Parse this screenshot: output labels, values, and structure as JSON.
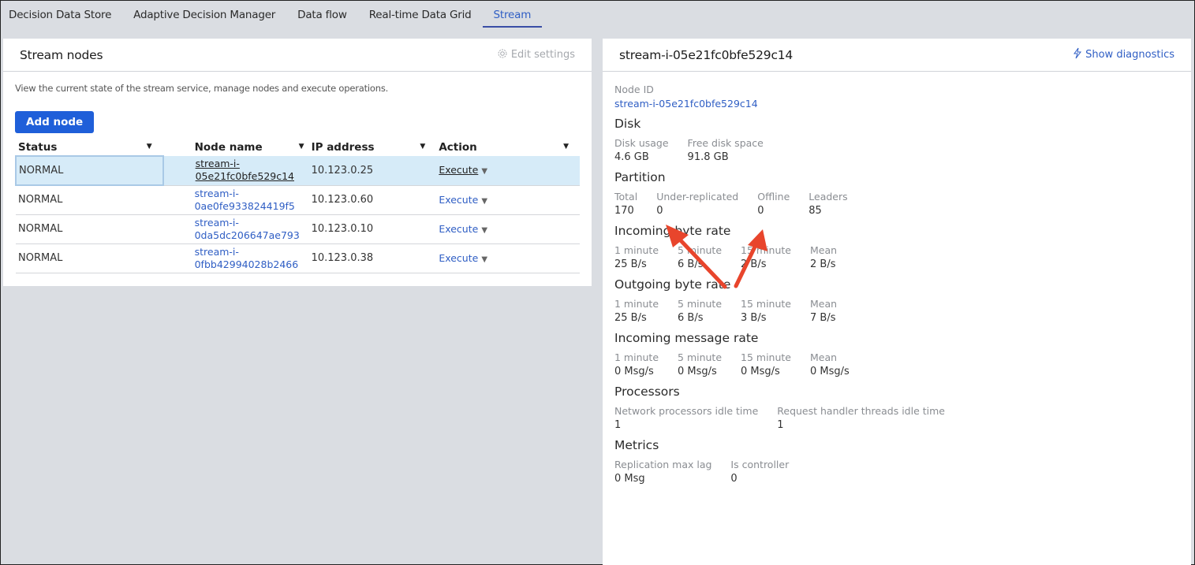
{
  "tabs": [
    {
      "label": "Decision Data Store",
      "active": false
    },
    {
      "label": "Adaptive Decision Manager",
      "active": false
    },
    {
      "label": "Data flow",
      "active": false
    },
    {
      "label": "Real-time Data Grid",
      "active": false
    },
    {
      "label": "Stream",
      "active": true
    }
  ],
  "left": {
    "title": "Stream nodes",
    "edit_settings": "Edit settings",
    "description": "View the current state of the stream service, manage nodes and execute operations.",
    "add_node": "Add node",
    "columns": [
      "Status",
      "Node name",
      "IP address",
      "Action"
    ],
    "rows": [
      {
        "status": "NORMAL",
        "node": "stream-i-05e21fc0bfe529c14",
        "ip": "10.123.0.25",
        "action": "Execute",
        "selected": true
      },
      {
        "status": "NORMAL",
        "node": "stream-i-0ae0fe933824419f5",
        "ip": "10.123.0.60",
        "action": "Execute",
        "selected": false
      },
      {
        "status": "NORMAL",
        "node": "stream-i-0da5dc206647ae793",
        "ip": "10.123.0.10",
        "action": "Execute",
        "selected": false
      },
      {
        "status": "NORMAL",
        "node": "stream-i-0fbb42994028b2466",
        "ip": "10.123.0.38",
        "action": "Execute",
        "selected": false
      }
    ]
  },
  "right": {
    "title": "stream-i-05e21fc0bfe529c14",
    "show_diagnostics": "Show diagnostics",
    "node_id_label": "Node ID",
    "node_id": "stream-i-05e21fc0bfe529c14",
    "disk": {
      "title": "Disk",
      "fields": [
        {
          "label": "Disk usage",
          "value": "4.6 GB"
        },
        {
          "label": "Free disk space",
          "value": "91.8 GB"
        }
      ]
    },
    "partition": {
      "title": "Partition",
      "fields": [
        {
          "label": "Total",
          "value": "170"
        },
        {
          "label": "Under-replicated",
          "value": "0"
        },
        {
          "label": "Offline",
          "value": "0"
        },
        {
          "label": "Leaders",
          "value": "85"
        }
      ]
    },
    "incoming_byte": {
      "title": "Incoming byte rate",
      "fields": [
        {
          "label": "1 minute",
          "value": "25 B/s"
        },
        {
          "label": "5 minute",
          "value": "6 B/s"
        },
        {
          "label": "15 minute",
          "value": "2 B/s"
        },
        {
          "label": "Mean",
          "value": "2 B/s"
        }
      ]
    },
    "outgoing_byte": {
      "title": "Outgoing byte rate",
      "fields": [
        {
          "label": "1 minute",
          "value": "25 B/s"
        },
        {
          "label": "5 minute",
          "value": "6 B/s"
        },
        {
          "label": "15 minute",
          "value": "3 B/s"
        },
        {
          "label": "Mean",
          "value": "7 B/s"
        }
      ]
    },
    "incoming_msg": {
      "title": "Incoming message rate",
      "fields": [
        {
          "label": "1 minute",
          "value": "0 Msg/s"
        },
        {
          "label": "5 minute",
          "value": "0 Msg/s"
        },
        {
          "label": "15 minute",
          "value": "0 Msg/s"
        },
        {
          "label": "Mean",
          "value": "0 Msg/s"
        }
      ]
    },
    "processors": {
      "title": "Processors",
      "fields": [
        {
          "label": "Network processors idle time",
          "value": "1"
        },
        {
          "label": "Request handler threads idle time",
          "value": "1"
        }
      ]
    },
    "metrics": {
      "title": "Metrics",
      "fields": [
        {
          "label": "Replication max lag",
          "value": "0 Msg"
        },
        {
          "label": "Is controller",
          "value": "0"
        }
      ]
    }
  },
  "colors": {
    "accent": "#2f5ec4",
    "button": "#1f5fd9",
    "selected_row": "#d6ebf8",
    "annotation": "#e8452c"
  }
}
